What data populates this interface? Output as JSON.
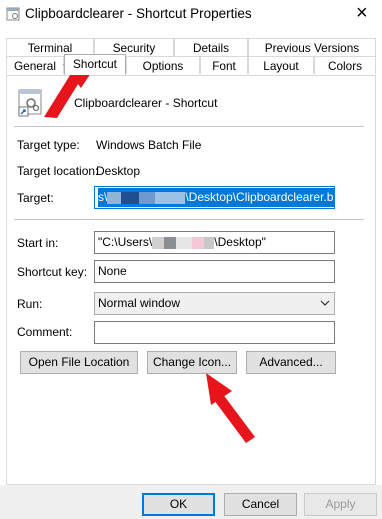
{
  "window": {
    "title": "Clipboardclearer - Shortcut Properties",
    "close_glyph": "×"
  },
  "tabs_back_row": [
    "Terminal",
    "Security",
    "Details",
    "Previous Versions"
  ],
  "tabs_front_row": [
    "General",
    "Shortcut",
    "Options",
    "Font",
    "Layout",
    "Colors"
  ],
  "active_tab": "Shortcut",
  "shortcut": {
    "name": "Clipboardclearer - Shortcut",
    "target_type_label": "Target type:",
    "target_type_value": "Windows Batch File",
    "target_location_label": "Target location:",
    "target_location_value": "Desktop",
    "target_label": "Target:",
    "target_prefix": "s\\",
    "target_suffix": "\\Desktop\\Clipboardclearer.bat\"",
    "start_in_label": "Start in:",
    "start_in_prefix": "\"C:\\Users\\",
    "start_in_suffix": "\\Desktop\"",
    "shortcut_key_label": "Shortcut key:",
    "shortcut_key_value": "None",
    "run_label": "Run:",
    "run_value": "Normal window",
    "comment_label": "Comment:",
    "comment_value": ""
  },
  "buttons": {
    "open_file_location": "Open File Location",
    "change_icon": "Change Icon...",
    "advanced": "Advanced...",
    "ok": "OK",
    "cancel": "Cancel",
    "apply": "Apply"
  },
  "colors": {
    "selection": "#0078d7",
    "annotation_arrow": "#e8141c"
  },
  "icons": [
    "batch-file-icon",
    "shortcut-arrow-icon",
    "dropdown-chevron-icon",
    "red-annotation-arrow"
  ]
}
